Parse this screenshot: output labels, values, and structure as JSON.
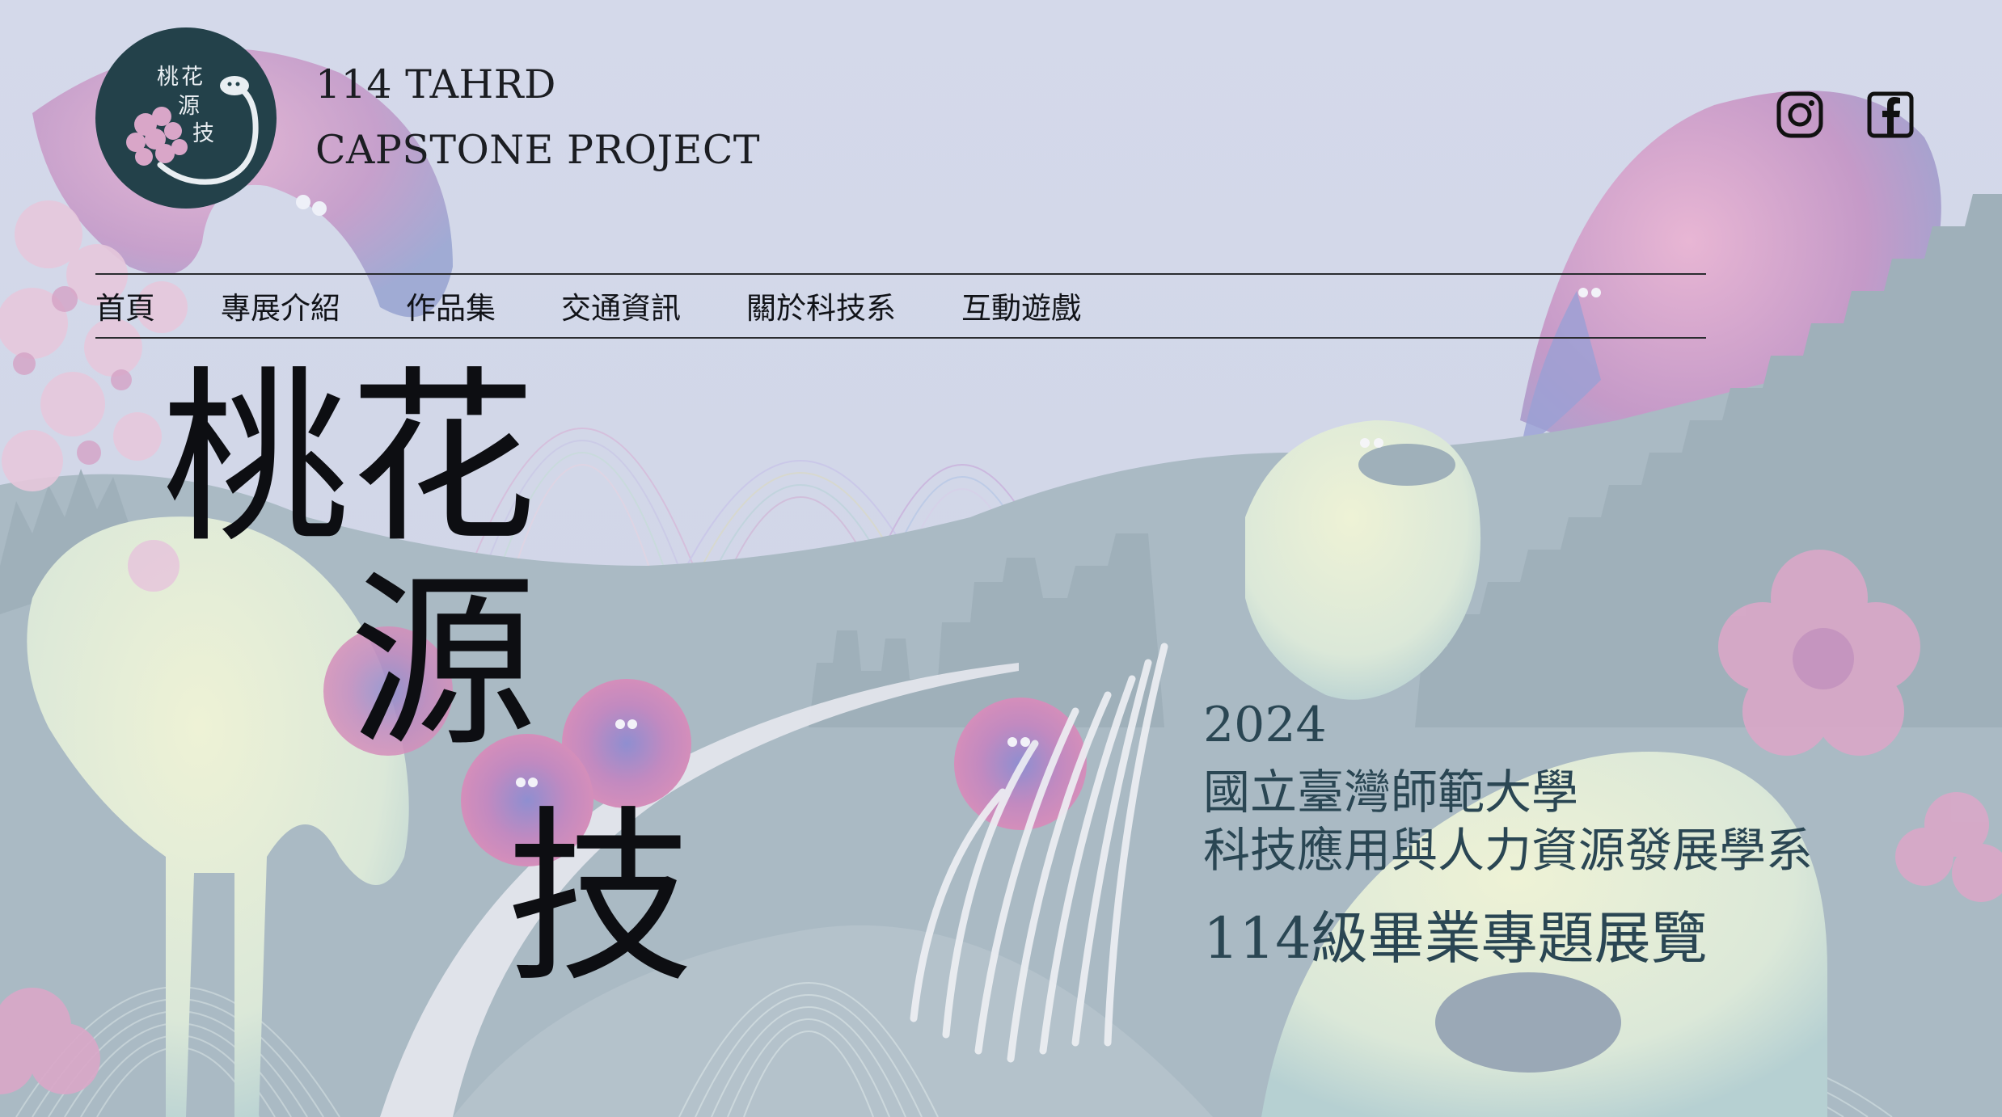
{
  "logo": {
    "chars": [
      "桃",
      "花",
      "源",
      "技"
    ]
  },
  "header": {
    "line1": "114 TAHRD",
    "line2": "CAPSTONE PROJECT"
  },
  "social": {
    "instagram_icon": "instagram-icon",
    "facebook_icon": "facebook-icon"
  },
  "nav": {
    "items": [
      "首頁",
      "專展介紹",
      "作品集",
      "交通資訊",
      "關於科技系",
      "互動遊戲"
    ]
  },
  "hero": {
    "title_chars": [
      "桃",
      "花",
      "源",
      "技"
    ]
  },
  "info": {
    "year": "2024",
    "university": "國立臺灣師範大學",
    "department": "科技應用與人力資源發展學系",
    "exhibition": "114級畢業專題展覽"
  },
  "colors": {
    "background": "#d3d8e8",
    "logo_bg": "#23414a",
    "info_text": "#2a4653",
    "pink": "#d8a6c8",
    "teal": "#a8bcc4",
    "cream": "#e4ecd8"
  }
}
